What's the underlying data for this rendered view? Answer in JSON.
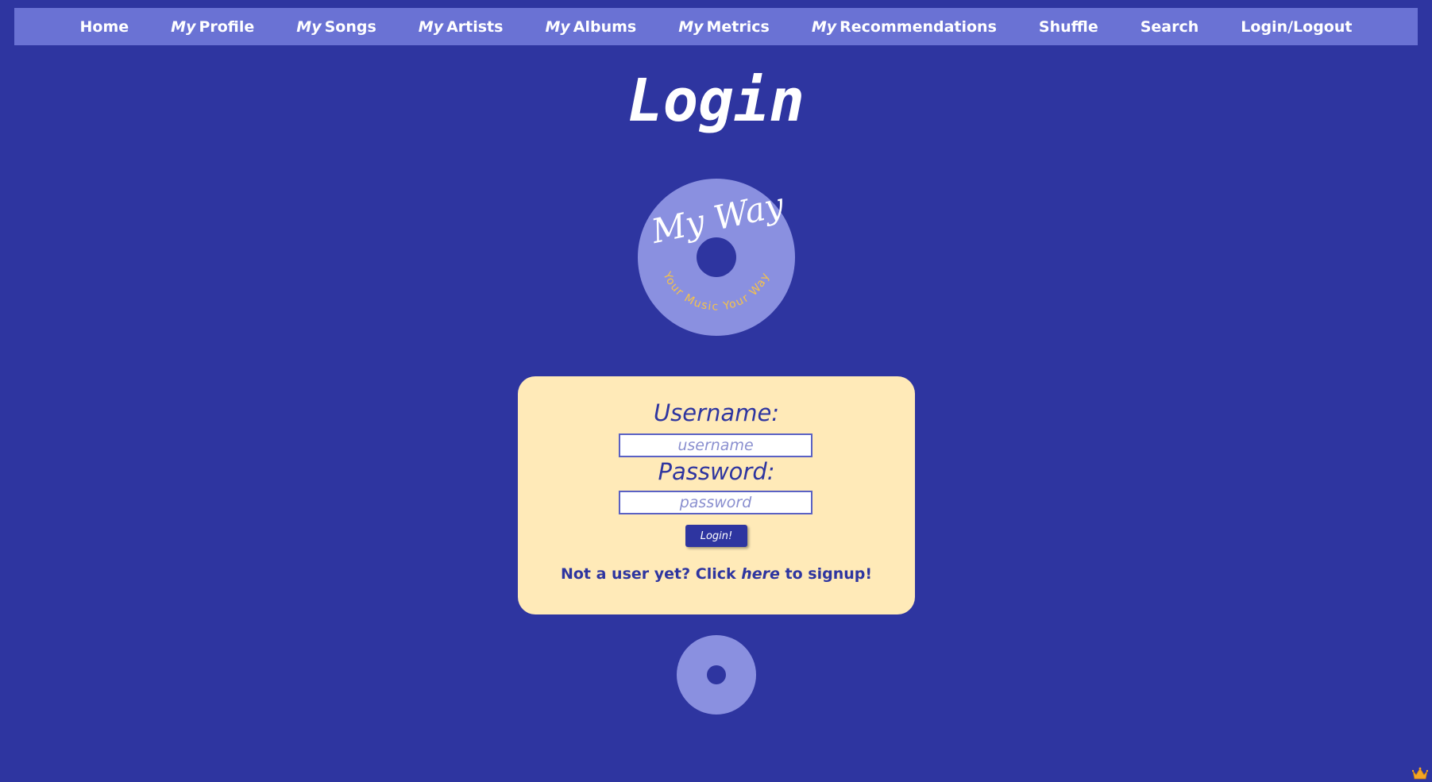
{
  "nav": {
    "home": "Home",
    "profile": {
      "prefix": "My",
      "label": "Profile"
    },
    "songs": {
      "prefix": "My",
      "label": "Songs"
    },
    "artists": {
      "prefix": "My",
      "label": "Artists"
    },
    "albums": {
      "prefix": "My",
      "label": "Albums"
    },
    "metrics": {
      "prefix": "My",
      "label": "Metrics"
    },
    "recommendations": {
      "prefix": "My",
      "label": "Recommendations"
    },
    "shuffle": "Shuffle",
    "search": "Search",
    "login_logout": "Login/Logout"
  },
  "page": {
    "title": "Login"
  },
  "logo": {
    "brand": "My Way",
    "tagline": "Your Music Your Way"
  },
  "form": {
    "username_label": "Username:",
    "username_placeholder": "username",
    "username_value": "",
    "password_label": "Password:",
    "password_placeholder": "password",
    "password_value": "",
    "submit_label": "Login!",
    "signup_prefix": "Not a user yet? Click ",
    "signup_link": "here",
    "signup_suffix": " to signup!"
  },
  "colors": {
    "background": "#2e35a0",
    "navbar": "#6a72d4",
    "disc": "#8a90e0",
    "card": "#ffeab8",
    "tagline": "#f5c24a",
    "accent": "#2e35a0"
  },
  "icons": {
    "corner": "crown-icon"
  }
}
